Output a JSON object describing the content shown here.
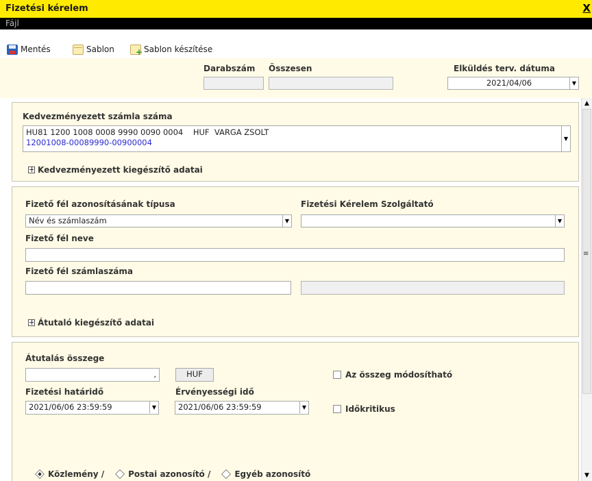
{
  "window": {
    "title": "Fizetési kérelem",
    "close_glyph": "X"
  },
  "menu": {
    "file": "Fájl"
  },
  "toolbar": {
    "save": "Mentés",
    "template": "Sablon",
    "create_template": "Sablon készítése"
  },
  "header": {
    "count_label": "Darabszám",
    "count_value": "",
    "total_label": "Összesen",
    "total_value": "",
    "send_date_label": "Elküldés terv. dátuma",
    "send_date_value": "2021/04/06"
  },
  "beneficiary": {
    "section_label": "Kedvezményezett számla száma",
    "account_line1": "HU81 1200 1008 0008 9990 0090 0004    HUF  VARGA ZSOLT",
    "account_line2": "12001008-00089990-00900004",
    "extra_toggle": "Kedvezményezett kiegészítő adatai"
  },
  "payer": {
    "id_type_label": "Fizető fél azonosításának típusa",
    "id_type_value": "Név és számlaszám",
    "provider_label": "Fizetési Kérelem Szolgáltató",
    "provider_value": "",
    "name_label": "Fizető fél neve",
    "name_value": "",
    "account_label": "Fizető fél számlaszáma",
    "account_value": "",
    "account_extra_value": "",
    "extra_toggle": "Átutaló kiegészítő adatai"
  },
  "transfer": {
    "amount_label": "Átutalás összege",
    "amount_value": ",",
    "currency": "HUF",
    "modifiable_label": "Az összeg módosítható",
    "modifiable_checked": false,
    "deadline_label": "Fizetési határidő",
    "deadline_value": "2021/06/06 23:59:59",
    "validity_label": "Érvényességi idő",
    "validity_value": "2021/06/06 23:59:59",
    "time_critical_label": "Időkritikus",
    "time_critical_checked": false,
    "reference_options": [
      "Közlemény /",
      "Postai azonosító /",
      "Egyéb azonosító"
    ],
    "reference_selected": "Közlemény /"
  },
  "colors": {
    "title_bar": "#ffea00",
    "menu_bar": "#000000",
    "panel_bg": "#fffbe6",
    "account_link": "#2a2ad0"
  },
  "icons": {
    "save": "save-icon",
    "template": "template-icon",
    "create_template": "create-template-icon",
    "expand": "plus-box-icon"
  }
}
